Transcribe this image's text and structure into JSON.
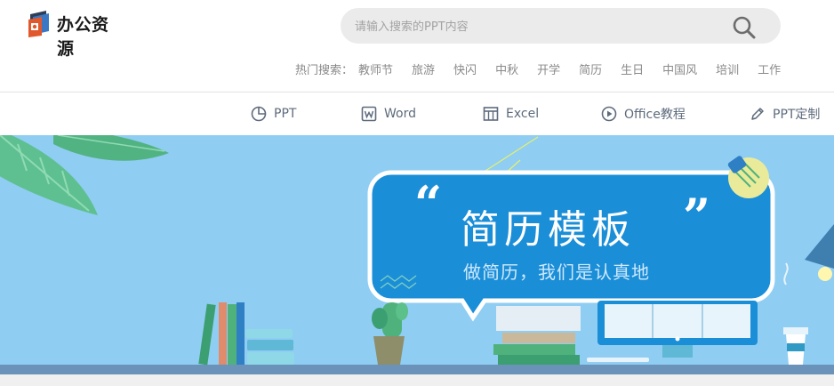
{
  "brand": {
    "name": "办公资源"
  },
  "search": {
    "placeholder": "请输入搜索的PPT内容"
  },
  "hot_search": {
    "label": "热门搜索：",
    "items": [
      "教师节",
      "旅游",
      "快闪",
      "中秋",
      "开学",
      "简历",
      "生日",
      "中国风",
      "培训",
      "工作"
    ]
  },
  "nav": {
    "items": [
      {
        "label": "PPT",
        "icon": "pie-chart-icon"
      },
      {
        "label": "Word",
        "icon": "word-icon"
      },
      {
        "label": "Excel",
        "icon": "table-icon"
      },
      {
        "label": "Office教程",
        "icon": "play-circle-icon"
      },
      {
        "label": "PPT定制",
        "icon": "pen-icon"
      }
    ]
  },
  "banner": {
    "title": "简历模板",
    "subtitle": "做简历，我们是认真地"
  },
  "colors": {
    "banner_bg": "#8fcdf3",
    "bubble": "#1b8ed8",
    "nav_text": "#5e6b7d",
    "hot_text": "#8a8a8a"
  }
}
